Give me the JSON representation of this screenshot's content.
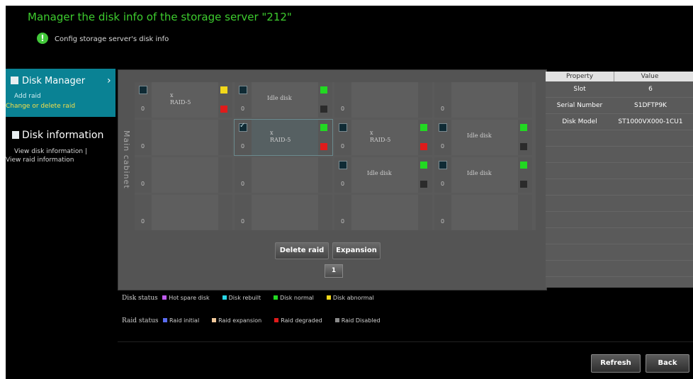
{
  "header": {
    "title": "Manager the disk info of the storage server \"212\"",
    "subtitle": "Config storage server's disk info",
    "subtitle_icon": "info-balloon-icon"
  },
  "sidebar": {
    "disk_manager": {
      "label": "Disk Manager",
      "arrow": "›",
      "items": [
        "Add raid",
        "Change or delete raid"
      ]
    },
    "disk_information": {
      "label": "Disk information",
      "items": [
        "View disk information  |",
        "View raid information"
      ]
    }
  },
  "cabinet": {
    "label": "Main cabinet",
    "rows": [
      [
        {
          "checked": false,
          "num": "0",
          "label": "x\nRAID-5",
          "top_color": "#f2d81a",
          "bottom_color": "#e01b1b"
        },
        {
          "checked": false,
          "num": "0",
          "label": "Idle disk",
          "top_color": "#22d922",
          "bottom_color": "#2b2b2b"
        },
        {
          "checked": null,
          "num": "0",
          "label": "",
          "top_color": null,
          "bottom_color": null
        },
        {
          "checked": null,
          "num": "0",
          "label": "",
          "top_color": null,
          "bottom_color": null
        }
      ],
      [
        {
          "checked": null,
          "num": "0",
          "label": "",
          "top_color": null,
          "bottom_color": null
        },
        {
          "checked": true,
          "num": "0",
          "label": "x\nRAID-5",
          "top_color": "#22d922",
          "bottom_color": "#e01b1b",
          "selected": true
        },
        {
          "checked": false,
          "num": "0",
          "label": "x\nRAID-5",
          "top_color": "#22d922",
          "bottom_color": "#e01b1b"
        },
        {
          "checked": false,
          "num": "0",
          "label": "Idle disk",
          "top_color": "#22d922",
          "bottom_color": "#2b2b2b"
        }
      ],
      [
        {
          "checked": null,
          "num": "0",
          "label": "",
          "top_color": null,
          "bottom_color": null
        },
        {
          "checked": null,
          "num": "0",
          "label": "",
          "top_color": null,
          "bottom_color": null
        },
        {
          "checked": false,
          "num": "0",
          "label": "Idle disk",
          "top_color": "#22d922",
          "bottom_color": "#2b2b2b"
        },
        {
          "checked": false,
          "num": "0",
          "label": "Idle disk",
          "top_color": "#22d922",
          "bottom_color": "#2b2b2b"
        }
      ],
      [
        {
          "checked": null,
          "num": "0",
          "label": "",
          "top_color": null,
          "bottom_color": null
        },
        {
          "checked": null,
          "num": "0",
          "label": "",
          "top_color": null,
          "bottom_color": null
        },
        {
          "checked": null,
          "num": "0",
          "label": "",
          "top_color": null,
          "bottom_color": null
        },
        {
          "checked": null,
          "num": "0",
          "label": "",
          "top_color": null,
          "bottom_color": null
        }
      ]
    ]
  },
  "actions": {
    "delete_raid": "Delete raid",
    "expansion": "Expansion",
    "page": "1"
  },
  "properties": {
    "col_property": "Property",
    "col_value": "Value",
    "rows": [
      {
        "key": "Slot",
        "value": "6"
      },
      {
        "key": "Serial Number",
        "value": "S1DFTP9K"
      },
      {
        "key": "Disk Model",
        "value": "ST1000VX000-1CU1"
      }
    ]
  },
  "legend": {
    "disk_status_title": "Disk status",
    "disk_status": [
      {
        "label": "Hot spare disk",
        "color": "#c05cf0"
      },
      {
        "label": "Disk rebuilt",
        "color": "#28d8e8"
      },
      {
        "label": "Disk normal",
        "color": "#22d922"
      },
      {
        "label": "Disk abnormal",
        "color": "#f2d81a"
      }
    ],
    "raid_status_title": "Raid status",
    "raid_status": [
      {
        "label": "Raid initial",
        "color": "#5a6cf0"
      },
      {
        "label": "Raid expansion",
        "color": "#f0c89a"
      },
      {
        "label": "Raid degraded",
        "color": "#e01b1b"
      },
      {
        "label": "Raid Disabled",
        "color": "#8a8a8a"
      }
    ]
  },
  "footer": {
    "refresh": "Refresh",
    "back": "Back"
  }
}
